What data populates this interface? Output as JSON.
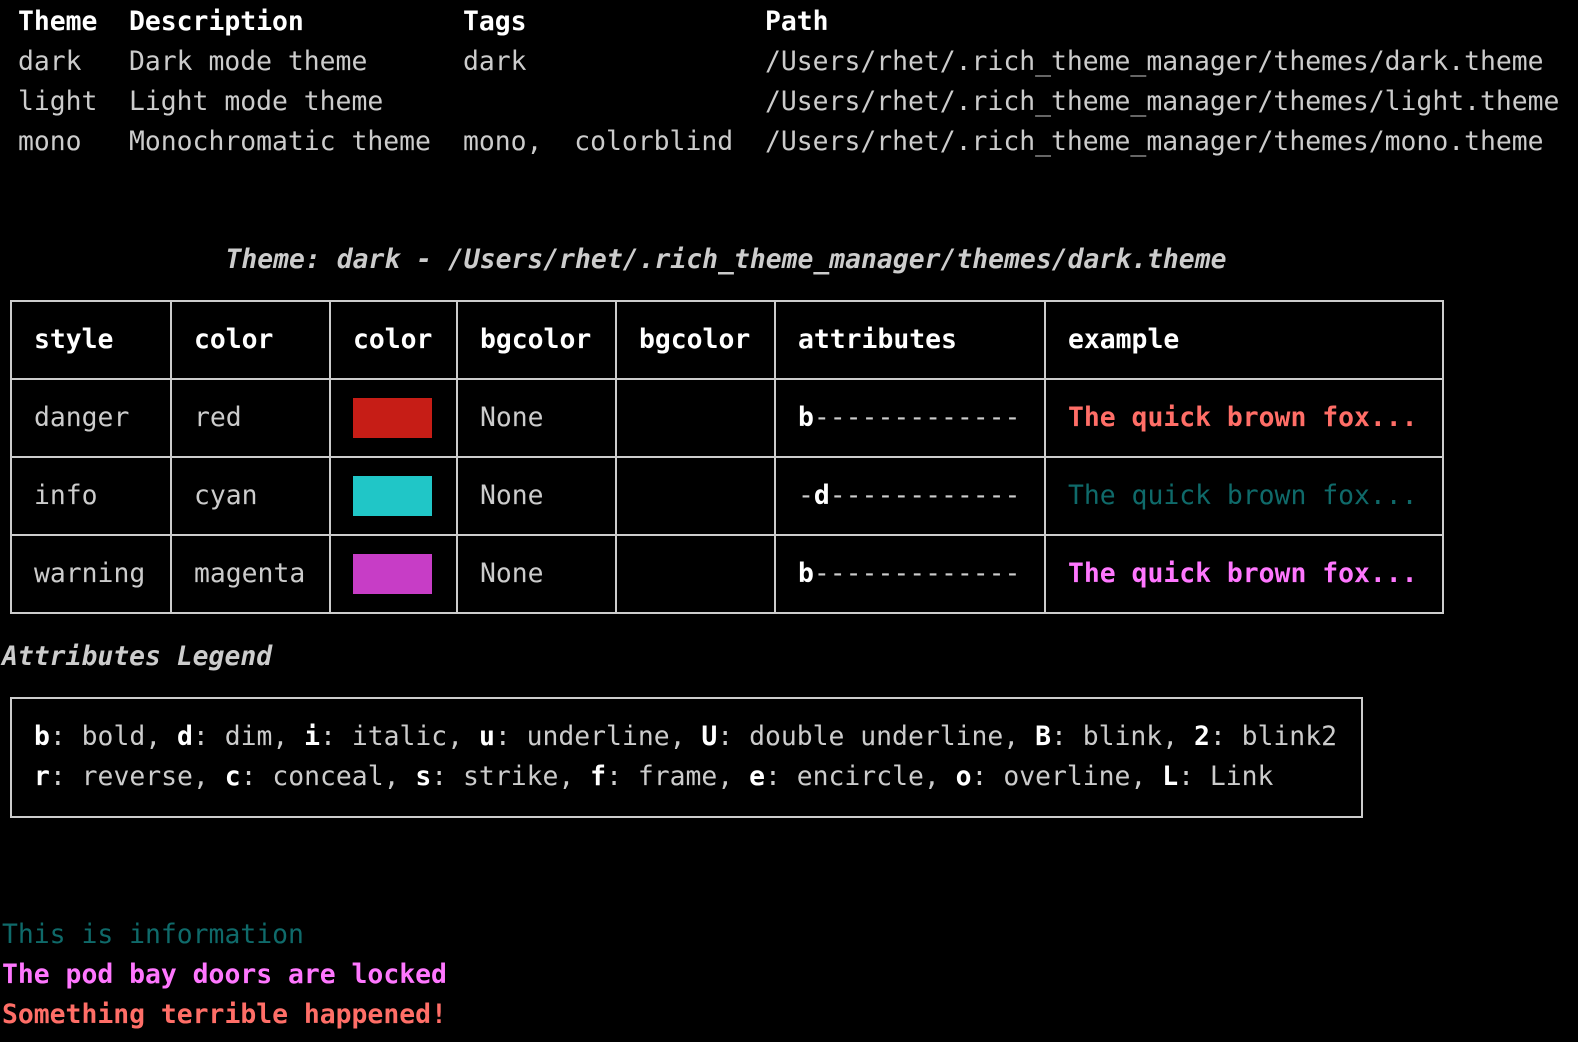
{
  "themes_table": {
    "headers": [
      "Theme",
      "Description",
      "Tags",
      "Path"
    ],
    "rows": [
      {
        "theme": "dark",
        "description": "Dark mode theme",
        "tags": "dark",
        "path": "/Users/rhet/.rich_theme_manager/themes/dark.theme"
      },
      {
        "theme": "light",
        "description": "Light mode theme",
        "tags": "",
        "path": "/Users/rhet/.rich_theme_manager/themes/light.theme"
      },
      {
        "theme": "mono",
        "description": "Monochromatic theme",
        "tags": "mono,  colorblind",
        "path": "/Users/rhet/.rich_theme_manager/themes/mono.theme"
      }
    ]
  },
  "theme_title": "Theme: dark - /Users/rhet/.rich_theme_manager/themes/dark.theme",
  "style_table": {
    "headers": [
      "style",
      "color",
      "color",
      "bgcolor",
      "bgcolor",
      "attributes",
      "example"
    ],
    "rows": [
      {
        "style": "danger",
        "color": "red",
        "swatch": "#c61d16",
        "bgcolor": "None",
        "attr_flag": "b",
        "attr_pre": "",
        "attr_post": "-------------",
        "example": "The quick brown fox...",
        "example_color": "#ff6e67",
        "example_bold": true
      },
      {
        "style": "info",
        "color": "cyan",
        "swatch": "#20c6c7",
        "bgcolor": "None",
        "attr_flag": "d",
        "attr_pre": "-",
        "attr_post": "------------",
        "example": "The quick brown fox...",
        "example_color": "#0f6a6a",
        "example_bold": false
      },
      {
        "style": "warning",
        "color": "magenta",
        "swatch": "#c73dc6",
        "bgcolor": "None",
        "attr_flag": "b",
        "attr_pre": "",
        "attr_post": "-------------",
        "example": "The quick brown fox...",
        "example_color": "#ff77ff",
        "example_bold": true
      }
    ]
  },
  "legend_title": "Attributes Legend",
  "legend": [
    [
      [
        "b",
        "bold"
      ],
      [
        "d",
        "dim"
      ],
      [
        "i",
        "italic"
      ],
      [
        "u",
        "underline"
      ],
      [
        "U",
        "double underline"
      ],
      [
        "B",
        "blink"
      ],
      [
        "2",
        "blink2"
      ]
    ],
    [
      [
        "r",
        "reverse"
      ],
      [
        "c",
        "conceal"
      ],
      [
        "s",
        "strike"
      ],
      [
        "f",
        "frame"
      ],
      [
        "e",
        "encircle"
      ],
      [
        "o",
        "overline"
      ],
      [
        "L",
        "Link"
      ]
    ]
  ],
  "messages": [
    {
      "text": "This is information",
      "color": "#0f6a6a",
      "bold": false
    },
    {
      "text": "The pod bay doors are locked",
      "color": "#ff77ff",
      "bold": true
    },
    {
      "text": "Something terrible happened!",
      "color": "#ff6e67",
      "bold": true
    }
  ]
}
